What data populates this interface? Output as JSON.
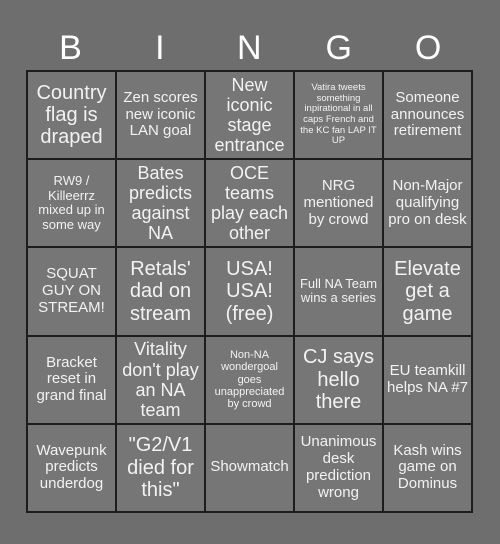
{
  "card": {
    "title_letters": [
      "B",
      "I",
      "N",
      "G",
      "O"
    ],
    "background_color": "#6e6e6e",
    "cell_color": "#767676",
    "grid_line_color": "#1d1d1d",
    "text_color": "#f2f2f2",
    "rows": 5,
    "columns": 5,
    "cells": [
      {
        "id": "b1",
        "text": "Country flag is draped",
        "size": "xl"
      },
      {
        "id": "i1",
        "text": "Zen scores new iconic LAN goal",
        "size": "md"
      },
      {
        "id": "n1",
        "text": "New iconic stage entrance",
        "size": "lg"
      },
      {
        "id": "g1",
        "text": "Vatira tweets something inpirational in all caps French and the KC fan LAP IT UP",
        "size": "xxs"
      },
      {
        "id": "o1",
        "text": "Someone announces retirement",
        "size": "md"
      },
      {
        "id": "b2",
        "text": "RW9 / Killeerrz mixed up in some way",
        "size": "sm"
      },
      {
        "id": "i2",
        "text": "Bates predicts against NA",
        "size": "lg"
      },
      {
        "id": "n2",
        "text": "OCE teams play each other",
        "size": "lg"
      },
      {
        "id": "g2",
        "text": "NRG mentioned by crowd",
        "size": "md"
      },
      {
        "id": "o2",
        "text": "Non-Major qualifying pro on desk",
        "size": "md"
      },
      {
        "id": "b3",
        "text": "SQUAT GUY ON STREAM!",
        "size": "md"
      },
      {
        "id": "i3",
        "text": "Retals' dad on stream",
        "size": "xl"
      },
      {
        "id": "n3",
        "text": "USA! USA! (free)",
        "size": "xl"
      },
      {
        "id": "g3",
        "text": "Full NA Team wins a series",
        "size": "sm"
      },
      {
        "id": "o3",
        "text": "Elevate get a game",
        "size": "xl"
      },
      {
        "id": "b4",
        "text": "Bracket reset in grand final",
        "size": "md"
      },
      {
        "id": "i4",
        "text": "Vitality don't play an NA team",
        "size": "lg"
      },
      {
        "id": "n4",
        "text": "Non-NA wondergoal goes unappreciated by crowd",
        "size": "xs"
      },
      {
        "id": "g4",
        "text": "CJ says hello there",
        "size": "xl"
      },
      {
        "id": "o4",
        "text": "EU teamkill helps NA #7",
        "size": "md"
      },
      {
        "id": "b5",
        "text": "Wavepunk predicts underdog",
        "size": "md"
      },
      {
        "id": "i5",
        "text": "\"G2/V1 died for this\"",
        "size": "xl"
      },
      {
        "id": "n5",
        "text": "Showmatch",
        "size": "md"
      },
      {
        "id": "g5",
        "text": "Unanimous desk prediction wrong",
        "size": "md"
      },
      {
        "id": "o5",
        "text": "Kash wins game on Dominus",
        "size": "md"
      }
    ]
  }
}
